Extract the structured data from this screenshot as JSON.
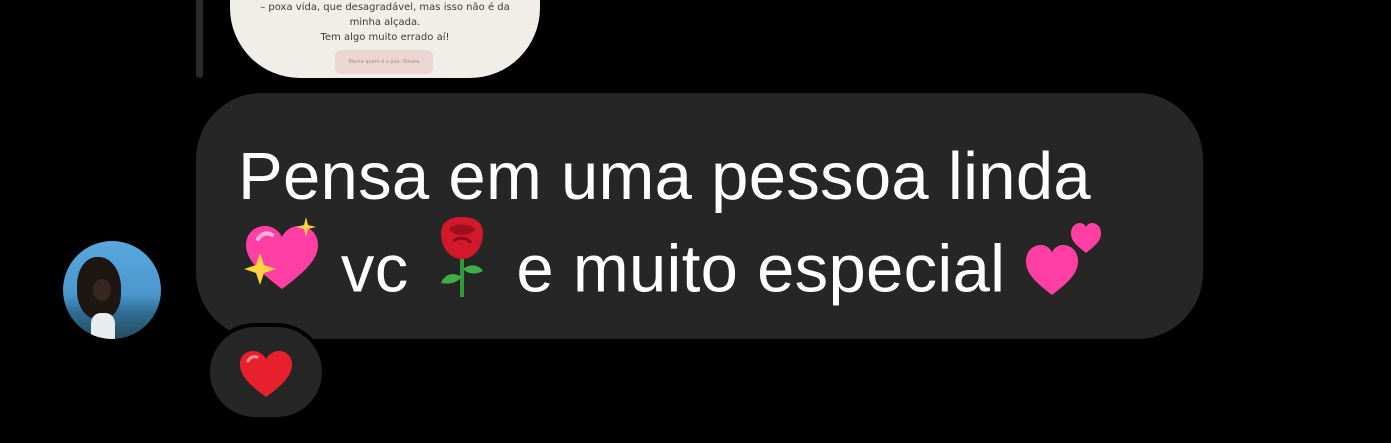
{
  "shared_post": {
    "line1": "– poxa vida, que desagradável, mas isso não é da",
    "line2": "minha alçada.",
    "line3": "Tem algo muito errado aí!",
    "button_label": "Marca quem é o juiz: Omara"
  },
  "message": {
    "line1": "Pensa em uma pessoa linda",
    "word_vc": "vc",
    "text_after_rose": "e muito especial",
    "emojis": [
      "sparkling-heart",
      "rose",
      "two-hearts"
    ]
  },
  "reaction": {
    "emoji": "red-heart"
  },
  "colors": {
    "background": "#000000",
    "bubble": "#262626",
    "text": "#ffffff",
    "heart": "#e8202e",
    "pink": "#ff3fa4",
    "sparkle": "#ffd23f"
  }
}
